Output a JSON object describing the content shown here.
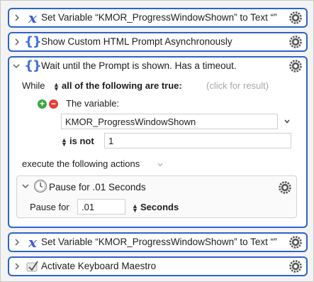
{
  "actions": [
    {
      "title": "Set Variable “KMOR_ProgressWindowShown” to Text “”",
      "icon": "variable-x-icon",
      "expanded": false
    },
    {
      "title": "Show Custom HTML Prompt Asynchronously",
      "icon": "html-braces-icon",
      "expanded": false
    },
    {
      "title": "Wait until the Prompt is shown. Has a timeout.",
      "icon": "html-braces-icon",
      "expanded": true,
      "while_label": "While",
      "condition_mode": "all of the following are true:",
      "click_hint": "(click for result)",
      "condition": {
        "label": "The variable:",
        "variable_name": "KMOR_ProgressWindowShown",
        "operator": "is not",
        "value": "1"
      },
      "execute_label": "execute the following actions",
      "inner_action": {
        "title": "Pause for .01 Seconds",
        "pause_label": "Pause for",
        "pause_value": ".01",
        "unit": "Seconds"
      }
    },
    {
      "title": "Set Variable “KMOR_ProgressWindowShown” to Text “”",
      "icon": "variable-x-icon",
      "expanded": false
    },
    {
      "title": "Activate Keyboard Maestro",
      "icon": "keyboard-maestro-icon",
      "expanded": false
    }
  ],
  "colors": {
    "action_border": "#2f63c7",
    "add_button": "#3aa845",
    "remove_button": "#e0403b"
  }
}
